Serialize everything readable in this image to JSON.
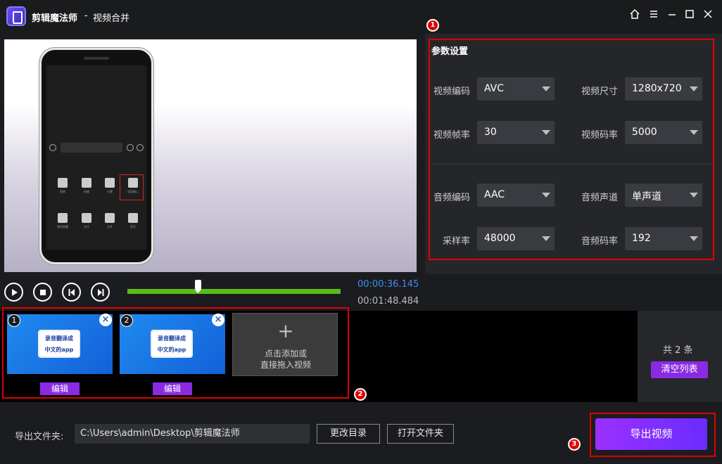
{
  "window": {
    "app_name": "剪辑魔法师",
    "separator": "-",
    "page_name": "视频合并",
    "controls": [
      "home-icon",
      "menu-icon",
      "minimize-icon",
      "maximize-icon",
      "close-icon"
    ]
  },
  "preview": {
    "phone_grid_labels": [
      "相册",
      "拍摄",
      "位置",
      "语音输入",
      "我的收藏",
      "名片",
      "文件",
      "音乐"
    ]
  },
  "settings": {
    "title": "参数设置",
    "video_codec": {
      "label": "视频编码",
      "value": "AVC"
    },
    "video_size": {
      "label": "视频尺寸",
      "value": "1280x720"
    },
    "frame_rate": {
      "label": "视频帧率",
      "value": "30"
    },
    "video_bitrate": {
      "label": "视频码率",
      "value": "5000"
    },
    "audio_codec": {
      "label": "音频编码",
      "value": "AAC"
    },
    "audio_channel": {
      "label": "音频声道",
      "value": "单声道"
    },
    "sample_rate": {
      "label": "采样率",
      "value": "48000"
    },
    "audio_bitrate": {
      "label": "音频码率",
      "value": "192"
    }
  },
  "badges": [
    "1",
    "2",
    "3"
  ],
  "playback": {
    "current_time": "00:00:36.145",
    "total_time": "00:01:48.484",
    "progress": 0.33
  },
  "clips": [
    {
      "index": "1",
      "thumb_line1": "录音翻译成",
      "thumb_line2": "中文的app",
      "edit_label": "编辑"
    },
    {
      "index": "2",
      "thumb_line1": "录音翻译成",
      "thumb_line2": "中文的app",
      "edit_label": "编辑"
    }
  ],
  "add_tile": {
    "plus": "+",
    "line1": "点击添加或",
    "line2": "直接拖入视频"
  },
  "list_panel": {
    "count": "共 2 条",
    "clear_label": "清空列表"
  },
  "export": {
    "folder_label": "导出文件夹:",
    "folder_path": "C:\\Users\\admin\\Desktop\\剪辑魔法师",
    "change_dir_label": "更改目录",
    "open_folder_label": "打开文件夹",
    "export_label": "导出视频"
  },
  "colors": {
    "accent_purple": "#8a2be2",
    "progress_green": "#5cbb1a",
    "time_blue": "#3d8ff5",
    "highlight_red": "#e00000"
  }
}
